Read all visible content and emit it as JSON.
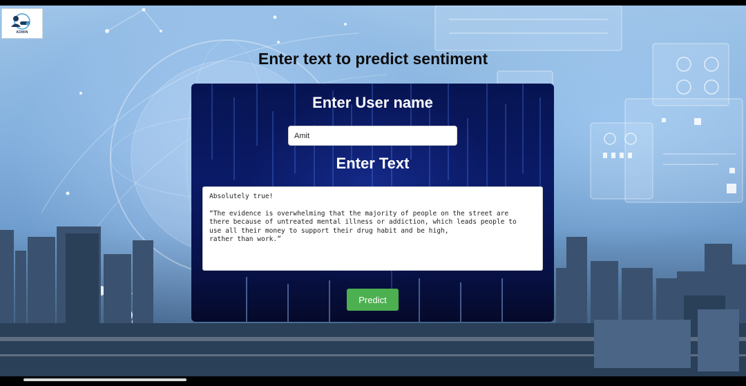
{
  "logo": {
    "label": "ADMIN"
  },
  "page": {
    "title": "Enter text to predict sentiment"
  },
  "form": {
    "username_heading": "Enter User name",
    "username_value": "Amit",
    "text_heading": "Enter Text",
    "text_value": "Absolutely true!\n\n“The evidence is overwhelming that the majority of people on the street are\nthere because of untreated mental illness or addiction, which leads people to\nuse all their money to support their drug habit and be high,\nrather than work.”",
    "predict_label": "Predict"
  },
  "colors": {
    "button": "#4caf50",
    "card_bg": "#0a1a66",
    "title_text": "#0d0d0d"
  }
}
